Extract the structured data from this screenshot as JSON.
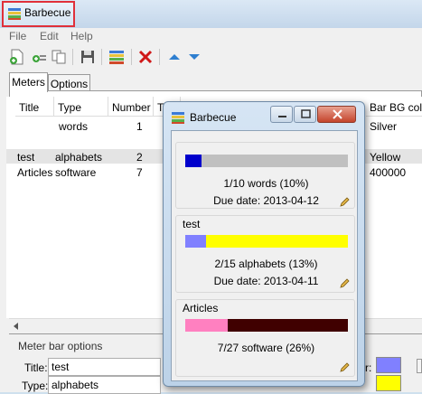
{
  "app": {
    "title": "Barbecue"
  },
  "menu": [
    "File",
    "Edit",
    "Help"
  ],
  "tabs": [
    "Meters",
    "Options"
  ],
  "grid": {
    "headers": [
      "Title",
      "Type",
      "Number",
      "To",
      "Bar BG color"
    ],
    "rows": [
      {
        "title": "",
        "type": "words",
        "number": "1",
        "bgcolor": "Silver"
      },
      {
        "title": "test",
        "type": "alphabets",
        "number": "2",
        "bgcolor": "Yellow"
      },
      {
        "title": "Articles",
        "type": "software",
        "number": "7",
        "bgcolor": "400000"
      }
    ]
  },
  "options": {
    "group_label": "Meter bar options",
    "title_label": "Title:",
    "title_value": "test",
    "type_label": "Type:",
    "type_value": "alphabets",
    "bar_color_label_partial": "r:"
  },
  "popup": {
    "title": "Barbecue",
    "meters": [
      {
        "title": "",
        "progress_text": "1/10 words (10%)",
        "due": "Due date: 2013-04-12",
        "fraction": 0.1,
        "fill": "#0000cc",
        "bg": "#c0c0c0"
      },
      {
        "title": "test",
        "progress_text": "2/15 alphabets (13%)",
        "due": "Due date: 2013-04-11",
        "fraction": 0.133,
        "fill": "#8080ff",
        "bg": "#ffff00"
      },
      {
        "title": "Articles",
        "progress_text": "7/27 software (26%)",
        "due": "",
        "fraction": 0.26,
        "fill": "#ff80c0",
        "bg": "#400000"
      }
    ]
  },
  "colors": {
    "swatch_bar": "#8080ff",
    "swatch_bg": "#ffff00",
    "title_highlight": "#e0303a"
  }
}
